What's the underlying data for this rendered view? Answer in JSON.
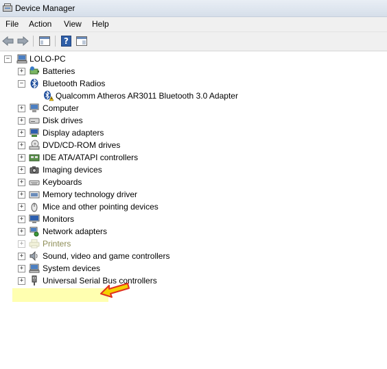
{
  "window": {
    "title": "Device Manager"
  },
  "menu": {
    "items": [
      "File",
      "Action",
      "View",
      "Help"
    ]
  },
  "tree": {
    "root": "LOLO-PC",
    "items": [
      {
        "label": "Batteries",
        "icon": "battery-icon"
      },
      {
        "label": "Bluetooth Radios",
        "icon": "bluetooth-icon",
        "expanded": true
      },
      {
        "label": "Qualcomm Atheros AR3011 Bluetooth 3.0 Adapter",
        "icon": "bluetooth-warning-icon",
        "child": true
      },
      {
        "label": "Computer",
        "icon": "computer-icon"
      },
      {
        "label": "Disk drives",
        "icon": "disk-drive-icon"
      },
      {
        "label": "Display adapters",
        "icon": "display-adapter-icon"
      },
      {
        "label": "DVD/CD-ROM drives",
        "icon": "dvd-drive-icon"
      },
      {
        "label": "IDE ATA/ATAPI controllers",
        "icon": "ide-controller-icon"
      },
      {
        "label": "Imaging devices",
        "icon": "camera-icon"
      },
      {
        "label": "Keyboards",
        "icon": "keyboard-icon"
      },
      {
        "label": "Memory technology driver",
        "icon": "memory-icon"
      },
      {
        "label": "Mice and other pointing devices",
        "icon": "mouse-icon"
      },
      {
        "label": "Monitors",
        "icon": "monitor-icon"
      },
      {
        "label": "Network adapters",
        "icon": "network-icon"
      },
      {
        "label": "Printers",
        "icon": "printer-icon",
        "highlighted": true
      },
      {
        "label": "Sound, video and game controllers",
        "icon": "speaker-icon"
      },
      {
        "label": "System devices",
        "icon": "system-devices-icon"
      },
      {
        "label": "Universal Serial Bus controllers",
        "icon": "usb-icon"
      }
    ]
  },
  "colors": {
    "highlight": "#ffffb0",
    "arrow": "#f5d000",
    "arrow_outline": "#e03020"
  }
}
